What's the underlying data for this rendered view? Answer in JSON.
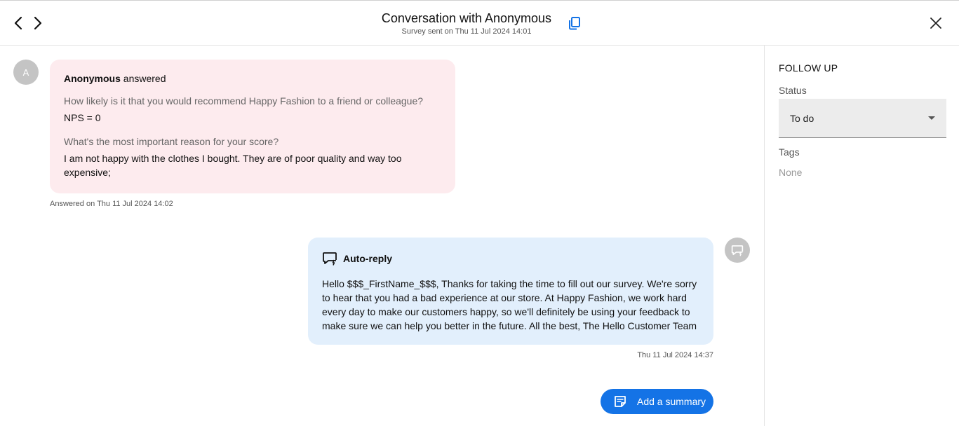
{
  "header": {
    "title": "Conversation with Anonymous",
    "subtitle": "Survey sent on Thu 11 Jul 2024 14:01",
    "prev_icon": "chevron-left-icon",
    "next_icon": "chevron-right-icon",
    "copy_icon": "copy-icon",
    "close_icon": "close-icon"
  },
  "answer": {
    "avatar_initial": "A",
    "respondent": "Anonymous",
    "action": "answered",
    "question1": "How likely is it that you would recommend Happy Fashion to a friend or colleague?",
    "answer1": "NPS = 0",
    "question2": "What's the most important reason for your score?",
    "answer2": "I am not happy with the clothes I bought. They are of poor quality and way too expensive;",
    "answered_on": "Answered on Thu 11 Jul 2024 14:02",
    "card_color": "#fdebee"
  },
  "reply": {
    "title": "Auto-reply",
    "text": "Hello $$$_FirstName_$$$, Thanks for taking the time to fill out our survey. We're sorry to hear that you had a bad experience at our store. At Happy Fashion, we work hard every day to make our customers happy, so we'll definitely be using your feedback to make sure we can help you better in the future. All the best, The Hello Customer Team",
    "time": "Thu 11 Jul 2024 14:37",
    "icon": "auto-reply-icon",
    "card_color": "#e2effc"
  },
  "summary_button": {
    "label": "Add a summary",
    "icon": "note-icon",
    "color": "#1473e6"
  },
  "follow_up": {
    "title": "FOLLOW UP",
    "status_label": "Status",
    "status_value": "To do",
    "tags_label": "Tags",
    "tags_value": "None"
  }
}
